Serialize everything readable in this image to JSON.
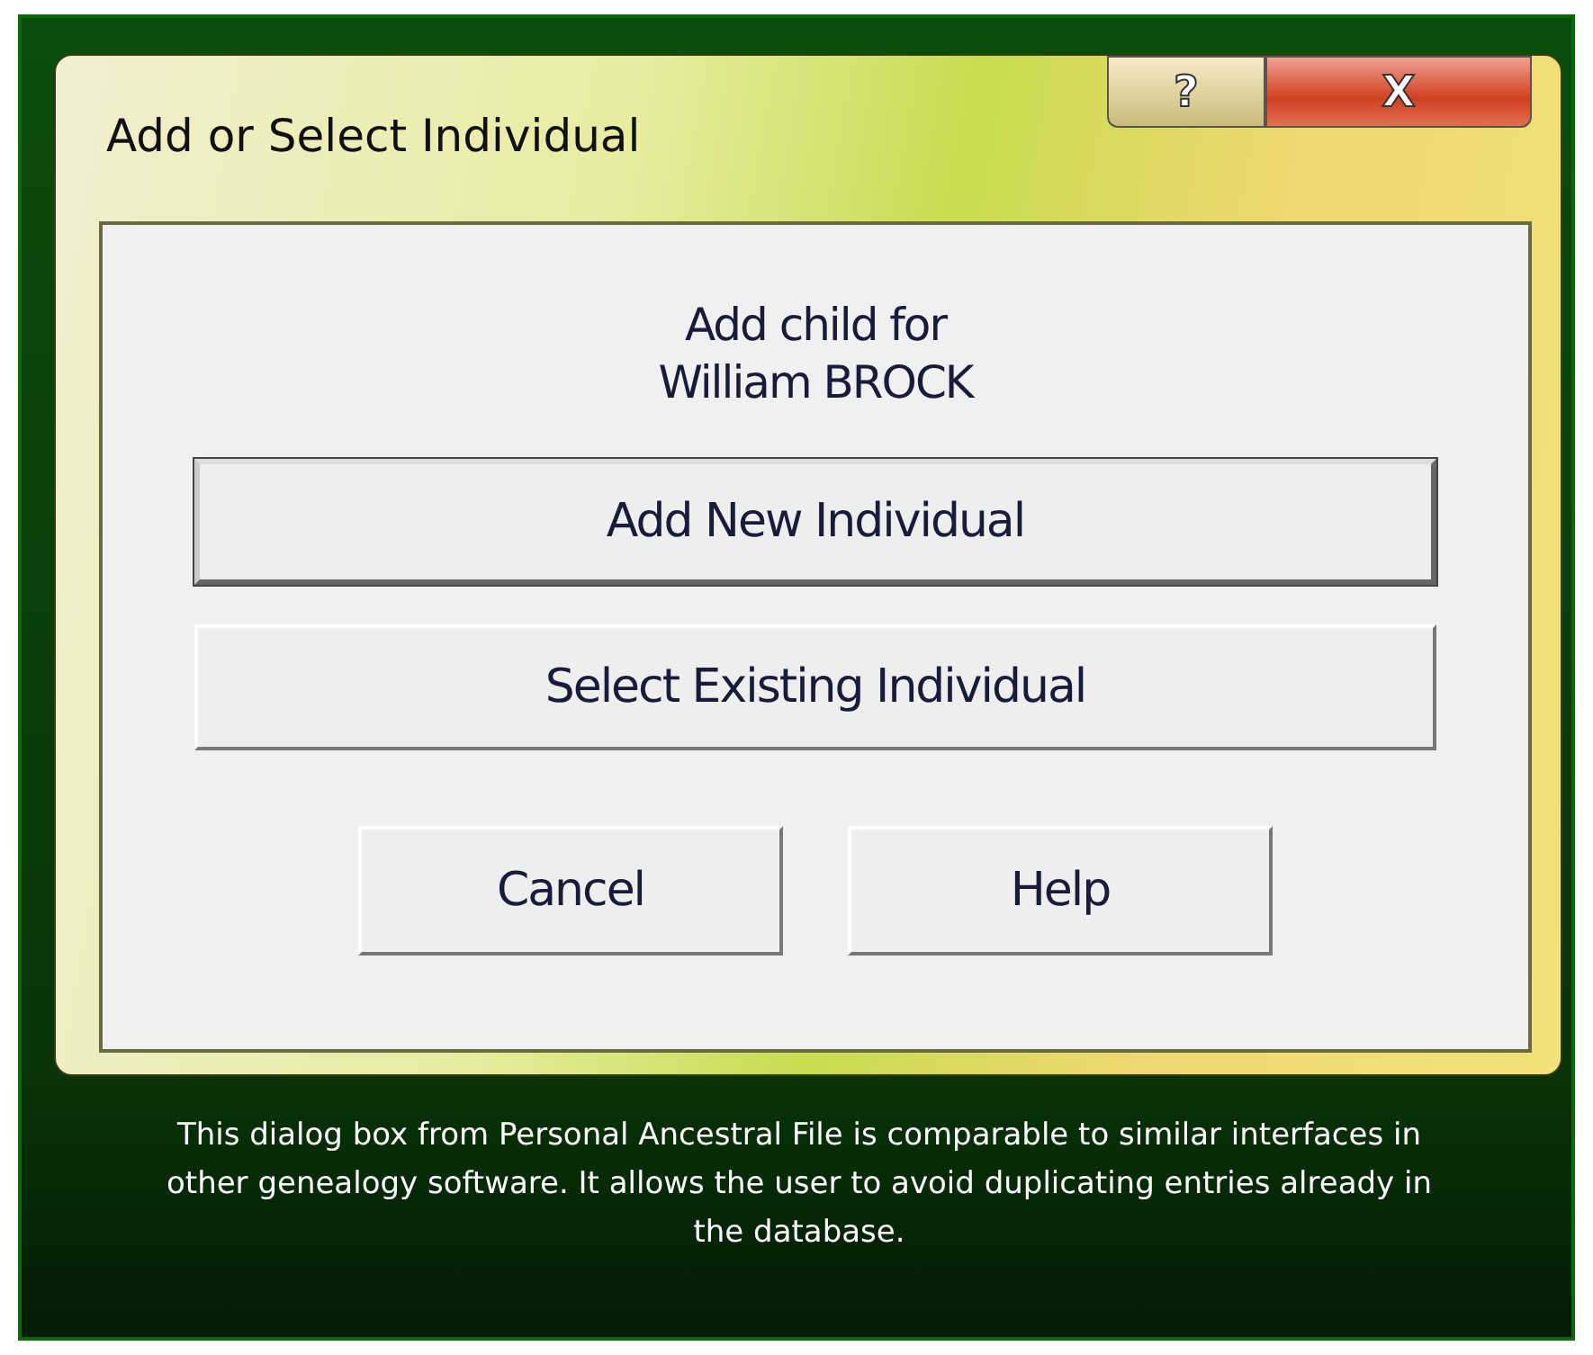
{
  "window": {
    "title": "Add or Select Individual",
    "title_buttons": [
      {
        "kind": "help",
        "label": "?"
      },
      {
        "kind": "close",
        "label": "X"
      }
    ]
  },
  "prompt": [
    "Add child for",
    "William BROCK"
  ],
  "actions": [
    {
      "label": "Add New Individual",
      "default": true
    },
    {
      "label": "Select Existing Individual",
      "default": false
    }
  ],
  "buttons": [
    {
      "label": "Cancel"
    },
    {
      "label": "Help"
    }
  ],
  "caption": "This dialog box from Personal Ancestral File is comparable to similar interfaces in other genealogy software. It allows the user to avoid duplicating entries already in the database."
}
